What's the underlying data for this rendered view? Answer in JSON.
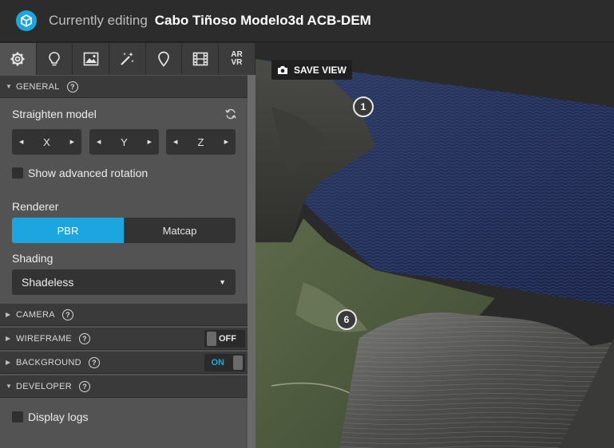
{
  "header": {
    "prefix": "Currently editing",
    "model_name": "Cabo Tiñoso Modelo3d ACB-DEM",
    "logo_icon": "cube-logo-icon",
    "accent_color": "#1ca6e0"
  },
  "tabs": [
    {
      "name": "gear-icon"
    },
    {
      "name": "lightbulb-icon"
    },
    {
      "name": "image-icon"
    },
    {
      "name": "magic-wand-icon"
    },
    {
      "name": "map-pin-icon"
    },
    {
      "name": "film-icon"
    },
    {
      "name": "ar-vr-icon",
      "label_top": "AR",
      "label_bottom": "VR"
    }
  ],
  "sections": {
    "general": "GENERAL",
    "camera": "CAMERA",
    "wireframe": "WIREFRAME",
    "background": "BACKGROUND",
    "developer": "DEVELOPER"
  },
  "general": {
    "straighten_label": "Straighten model",
    "axes": [
      "X",
      "Y",
      "Z"
    ],
    "advanced_rotation_label": "Show advanced rotation",
    "renderer_label": "Renderer",
    "renderer_options": [
      "PBR",
      "Matcap"
    ],
    "renderer_selected": "PBR",
    "shading_label": "Shading",
    "shading_value": "Shadeless"
  },
  "toggles": {
    "wireframe": "OFF",
    "background": "ON"
  },
  "developer": {
    "display_logs_label": "Display logs"
  },
  "viewport": {
    "save_view_label": "SAVE VIEW",
    "hotspots": [
      "1",
      "6"
    ]
  }
}
